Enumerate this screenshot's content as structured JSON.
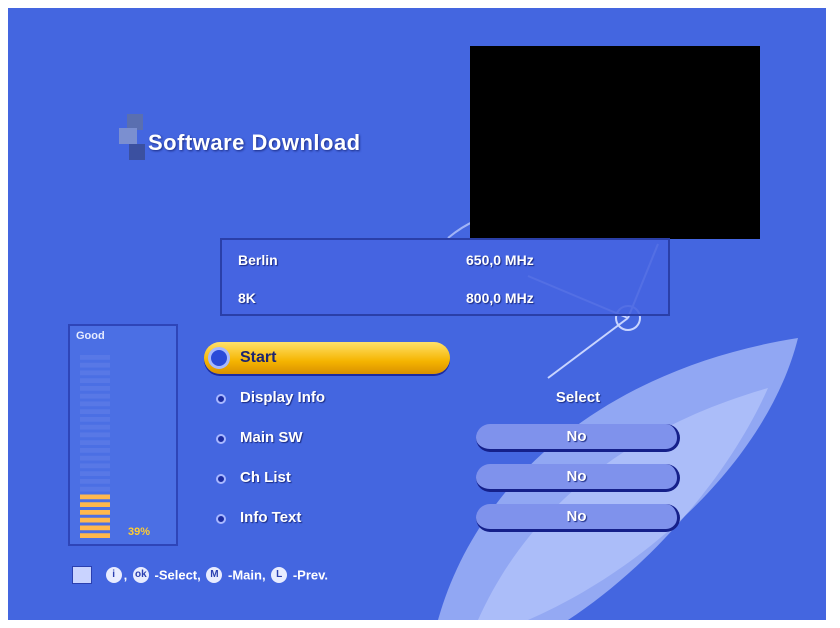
{
  "title": "Software Download",
  "info": [
    {
      "left": "Berlin",
      "right": "650,0 MHz"
    },
    {
      "left": "8K",
      "right": "800,0 MHz"
    }
  ],
  "signal": {
    "label": "Good",
    "value": "39%",
    "level": 0.39
  },
  "menu": {
    "start": "Start",
    "items": [
      {
        "label": "Display Info",
        "value": "Select"
      },
      {
        "label": "Main SW",
        "value": "No"
      },
      {
        "label": "Ch List",
        "value": "No"
      },
      {
        "label": "Info Text",
        "value": "No"
      }
    ]
  },
  "help": {
    "select_text": "-Select,",
    "main_text": "-Main,",
    "prev_text": "-Prev."
  },
  "colors": {
    "background": "#4466e0",
    "highlight": "#f5b400",
    "signal_bar": "#ffb84d"
  }
}
